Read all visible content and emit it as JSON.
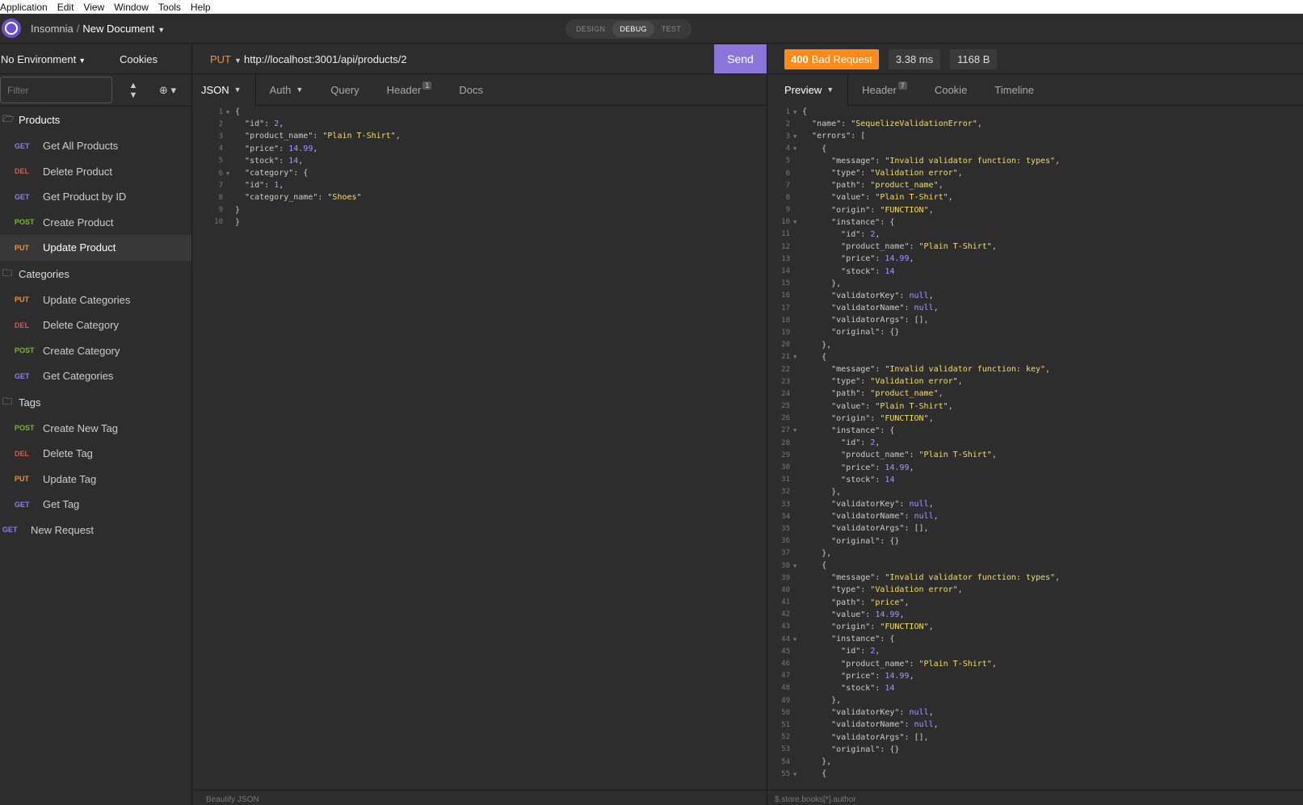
{
  "menu": [
    "Application",
    "Edit",
    "View",
    "Window",
    "Tools",
    "Help"
  ],
  "header": {
    "app": "Insomnia",
    "separator": "/",
    "document": "New Document",
    "modes": [
      "DESIGN",
      "DEBUG",
      "TEST"
    ],
    "active_mode": "DEBUG"
  },
  "sidebar": {
    "environment": "No Environment",
    "cookies": "Cookies",
    "filter_placeholder": "Filter",
    "folders": [
      {
        "name": "Products",
        "items": [
          {
            "method": "GET",
            "label": "Get All Products"
          },
          {
            "method": "DEL",
            "label": "Delete Product"
          },
          {
            "method": "GET",
            "label": "Get Product by ID"
          },
          {
            "method": "POST",
            "label": "Create Product"
          },
          {
            "method": "PUT",
            "label": "Update Product"
          }
        ]
      },
      {
        "name": "Categories",
        "items": [
          {
            "method": "PUT",
            "label": "Update Categories"
          },
          {
            "method": "DEL",
            "label": "Delete Category"
          },
          {
            "method": "POST",
            "label": "Create Category"
          },
          {
            "method": "GET",
            "label": "Get Categories"
          }
        ]
      },
      {
        "name": "Tags",
        "items": [
          {
            "method": "POST",
            "label": "Create New Tag"
          },
          {
            "method": "DEL",
            "label": "Delete Tag"
          },
          {
            "method": "PUT",
            "label": "Update Tag"
          },
          {
            "method": "GET",
            "label": "Get Tag"
          }
        ]
      }
    ],
    "root_request": {
      "method": "GET",
      "label": "New Request"
    }
  },
  "request": {
    "method": "PUT",
    "url": "http://localhost:3001/api/products/2",
    "send_label": "Send",
    "tabs": [
      {
        "label": "JSON",
        "caret": true
      },
      {
        "label": "Auth",
        "caret": true
      },
      {
        "label": "Query"
      },
      {
        "label": "Header",
        "badge": "1"
      },
      {
        "label": "Docs"
      }
    ],
    "body_lines": [
      "{",
      "  \"id\": 2,",
      "  \"product_name\": \"Plain T-Shirt\",",
      "  \"price\": 14.99,",
      "  \"stock\": 14,",
      "  \"category\": {",
      "  \"id\": 1,",
      "  \"category_name\": \"Shoes\"",
      "}",
      "}"
    ],
    "footer": "Beautify JSON"
  },
  "response": {
    "status_code": "400",
    "status_text": "Bad Request",
    "time": "3.38 ms",
    "size": "1168 B",
    "tabs": [
      {
        "label": "Preview",
        "caret": true
      },
      {
        "label": "Header",
        "badge": "7"
      },
      {
        "label": "Cookie"
      },
      {
        "label": "Timeline"
      }
    ],
    "body_lines": [
      "{",
      "  \"name\": \"SequelizeValidationError\",",
      "  \"errors\": [",
      "    {",
      "      \"message\": \"Invalid validator function: types\",",
      "      \"type\": \"Validation error\",",
      "      \"path\": \"product_name\",",
      "      \"value\": \"Plain T-Shirt\",",
      "      \"origin\": \"FUNCTION\",",
      "      \"instance\": {",
      "        \"id\": 2,",
      "        \"product_name\": \"Plain T-Shirt\",",
      "        \"price\": 14.99,",
      "        \"stock\": 14",
      "      },",
      "      \"validatorKey\": null,",
      "      \"validatorName\": null,",
      "      \"validatorArgs\": [],",
      "      \"original\": {}",
      "    },",
      "    {",
      "      \"message\": \"Invalid validator function: key\",",
      "      \"type\": \"Validation error\",",
      "      \"path\": \"product_name\",",
      "      \"value\": \"Plain T-Shirt\",",
      "      \"origin\": \"FUNCTION\",",
      "      \"instance\": {",
      "        \"id\": 2,",
      "        \"product_name\": \"Plain T-Shirt\",",
      "        \"price\": 14.99,",
      "        \"stock\": 14",
      "      },",
      "      \"validatorKey\": null,",
      "      \"validatorName\": null,",
      "      \"validatorArgs\": [],",
      "      \"original\": {}",
      "    },",
      "    {",
      "      \"message\": \"Invalid validator function: types\",",
      "      \"type\": \"Validation error\",",
      "      \"path\": \"price\",",
      "      \"value\": 14.99,",
      "      \"origin\": \"FUNCTION\",",
      "      \"instance\": {",
      "        \"id\": 2,",
      "        \"product_name\": \"Plain T-Shirt\",",
      "        \"price\": 14.99,",
      "        \"stock\": 14",
      "      },",
      "      \"validatorKey\": null,",
      "      \"validatorName\": null,",
      "      \"validatorArgs\": [],",
      "      \"original\": {}",
      "    },",
      "    {"
    ],
    "footer": "$.store.books[*].author"
  },
  "colors": {
    "accent": "#8876d8",
    "status_warning": "#ff8c1a",
    "get": "#8e7ef1",
    "delete": "#e5533d",
    "post": "#75ba24",
    "put": "#ff8c2a",
    "string": "#f3df6d",
    "number": "#a796ff"
  }
}
